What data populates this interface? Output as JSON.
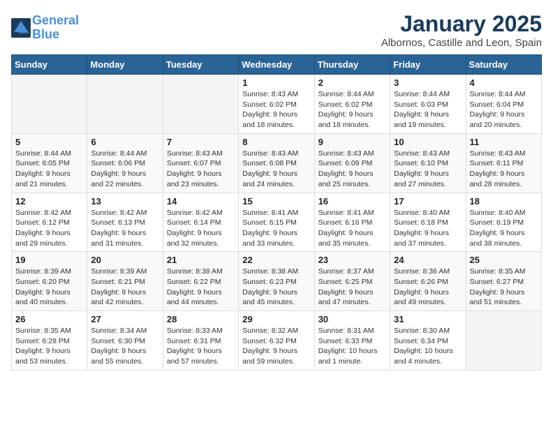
{
  "logo": {
    "line1": "General",
    "line2": "Blue"
  },
  "title": "January 2025",
  "subtitle": "Albornos, Castille and Leon, Spain",
  "weekdays": [
    "Sunday",
    "Monday",
    "Tuesday",
    "Wednesday",
    "Thursday",
    "Friday",
    "Saturday"
  ],
  "weeks": [
    [
      {
        "day": "",
        "info": ""
      },
      {
        "day": "",
        "info": ""
      },
      {
        "day": "",
        "info": ""
      },
      {
        "day": "1",
        "info": "Sunrise: 8:43 AM\nSunset: 6:02 PM\nDaylight: 9 hours and 18 minutes."
      },
      {
        "day": "2",
        "info": "Sunrise: 8:44 AM\nSunset: 6:02 PM\nDaylight: 9 hours and 18 minutes."
      },
      {
        "day": "3",
        "info": "Sunrise: 8:44 AM\nSunset: 6:03 PM\nDaylight: 9 hours and 19 minutes."
      },
      {
        "day": "4",
        "info": "Sunrise: 8:44 AM\nSunset: 6:04 PM\nDaylight: 9 hours and 20 minutes."
      }
    ],
    [
      {
        "day": "5",
        "info": "Sunrise: 8:44 AM\nSunset: 6:05 PM\nDaylight: 9 hours and 21 minutes."
      },
      {
        "day": "6",
        "info": "Sunrise: 8:44 AM\nSunset: 6:06 PM\nDaylight: 9 hours and 22 minutes."
      },
      {
        "day": "7",
        "info": "Sunrise: 8:43 AM\nSunset: 6:07 PM\nDaylight: 9 hours and 23 minutes."
      },
      {
        "day": "8",
        "info": "Sunrise: 8:43 AM\nSunset: 6:08 PM\nDaylight: 9 hours and 24 minutes."
      },
      {
        "day": "9",
        "info": "Sunrise: 8:43 AM\nSunset: 6:09 PM\nDaylight: 9 hours and 25 minutes."
      },
      {
        "day": "10",
        "info": "Sunrise: 8:43 AM\nSunset: 6:10 PM\nDaylight: 9 hours and 27 minutes."
      },
      {
        "day": "11",
        "info": "Sunrise: 8:43 AM\nSunset: 6:11 PM\nDaylight: 9 hours and 28 minutes."
      }
    ],
    [
      {
        "day": "12",
        "info": "Sunrise: 8:42 AM\nSunset: 6:12 PM\nDaylight: 9 hours and 29 minutes."
      },
      {
        "day": "13",
        "info": "Sunrise: 8:42 AM\nSunset: 6:13 PM\nDaylight: 9 hours and 31 minutes."
      },
      {
        "day": "14",
        "info": "Sunrise: 8:42 AM\nSunset: 6:14 PM\nDaylight: 9 hours and 32 minutes."
      },
      {
        "day": "15",
        "info": "Sunrise: 8:41 AM\nSunset: 6:15 PM\nDaylight: 9 hours and 33 minutes."
      },
      {
        "day": "16",
        "info": "Sunrise: 8:41 AM\nSunset: 6:16 PM\nDaylight: 9 hours and 35 minutes."
      },
      {
        "day": "17",
        "info": "Sunrise: 8:40 AM\nSunset: 6:18 PM\nDaylight: 9 hours and 37 minutes."
      },
      {
        "day": "18",
        "info": "Sunrise: 8:40 AM\nSunset: 6:19 PM\nDaylight: 9 hours and 38 minutes."
      }
    ],
    [
      {
        "day": "19",
        "info": "Sunrise: 8:39 AM\nSunset: 6:20 PM\nDaylight: 9 hours and 40 minutes."
      },
      {
        "day": "20",
        "info": "Sunrise: 8:39 AM\nSunset: 6:21 PM\nDaylight: 9 hours and 42 minutes."
      },
      {
        "day": "21",
        "info": "Sunrise: 8:38 AM\nSunset: 6:22 PM\nDaylight: 9 hours and 44 minutes."
      },
      {
        "day": "22",
        "info": "Sunrise: 8:38 AM\nSunset: 6:23 PM\nDaylight: 9 hours and 45 minutes."
      },
      {
        "day": "23",
        "info": "Sunrise: 8:37 AM\nSunset: 6:25 PM\nDaylight: 9 hours and 47 minutes."
      },
      {
        "day": "24",
        "info": "Sunrise: 8:36 AM\nSunset: 6:26 PM\nDaylight: 9 hours and 49 minutes."
      },
      {
        "day": "25",
        "info": "Sunrise: 8:35 AM\nSunset: 6:27 PM\nDaylight: 9 hours and 51 minutes."
      }
    ],
    [
      {
        "day": "26",
        "info": "Sunrise: 8:35 AM\nSunset: 6:28 PM\nDaylight: 9 hours and 53 minutes."
      },
      {
        "day": "27",
        "info": "Sunrise: 8:34 AM\nSunset: 6:30 PM\nDaylight: 9 hours and 55 minutes."
      },
      {
        "day": "28",
        "info": "Sunrise: 8:33 AM\nSunset: 6:31 PM\nDaylight: 9 hours and 57 minutes."
      },
      {
        "day": "29",
        "info": "Sunrise: 8:32 AM\nSunset: 6:32 PM\nDaylight: 9 hours and 59 minutes."
      },
      {
        "day": "30",
        "info": "Sunrise: 8:31 AM\nSunset: 6:33 PM\nDaylight: 10 hours and 1 minute."
      },
      {
        "day": "31",
        "info": "Sunrise: 8:30 AM\nSunset: 6:34 PM\nDaylight: 10 hours and 4 minutes."
      },
      {
        "day": "",
        "info": ""
      }
    ]
  ]
}
